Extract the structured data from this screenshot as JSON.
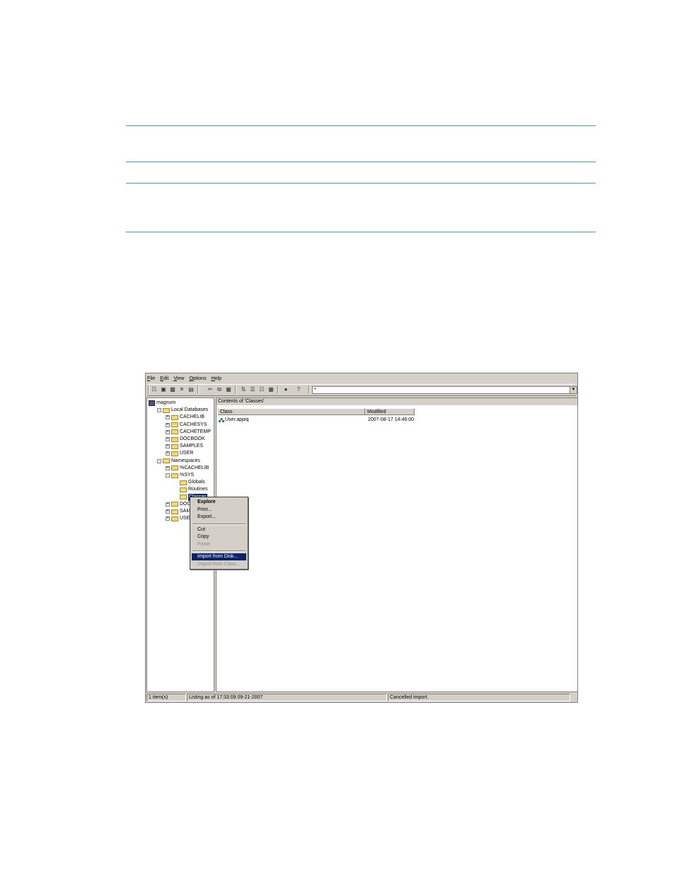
{
  "window": {
    "menu": [
      "File",
      "Edit",
      "View",
      "Options",
      "Help"
    ],
    "filter_value": "*",
    "tree": [
      {
        "label": "magnum",
        "depth": 0,
        "icon": "computer-icon",
        "expander": ""
      },
      {
        "label": "Local Databases",
        "depth": 1,
        "icon": "folder-icon",
        "expander": "-"
      },
      {
        "label": "CACHELIB",
        "depth": 2,
        "icon": "folder-icon",
        "expander": "+"
      },
      {
        "label": "CACHESYS",
        "depth": 2,
        "icon": "folder-icon",
        "expander": "+"
      },
      {
        "label": "CACHETEMP",
        "depth": 2,
        "icon": "folder-icon",
        "expander": "+"
      },
      {
        "label": "DOCBOOK",
        "depth": 2,
        "icon": "folder-icon",
        "expander": "+"
      },
      {
        "label": "SAMPLES",
        "depth": 2,
        "icon": "folder-icon",
        "expander": "+"
      },
      {
        "label": "USER",
        "depth": 2,
        "icon": "folder-icon",
        "expander": "+"
      },
      {
        "label": "Namespaces",
        "depth": 1,
        "icon": "folder-icon",
        "expander": "-"
      },
      {
        "label": "%CACHELIB",
        "depth": 2,
        "icon": "folder-icon",
        "expander": "+"
      },
      {
        "label": "%SYS",
        "depth": 2,
        "icon": "folder-icon",
        "expander": "-"
      },
      {
        "label": "Globals",
        "depth": 3,
        "icon": "folder-icon",
        "expander": ""
      },
      {
        "label": "Routines",
        "depth": 3,
        "icon": "folder-icon",
        "expander": ""
      },
      {
        "label": "Classes",
        "depth": 3,
        "icon": "folder-icon",
        "expander": "",
        "selected": true
      },
      {
        "label": "DOCBOO",
        "depth": 2,
        "icon": "folder-icon",
        "expander": "+"
      },
      {
        "label": "SAMPLE",
        "depth": 2,
        "icon": "folder-icon",
        "expander": "+"
      },
      {
        "label": "USER",
        "depth": 2,
        "icon": "folder-icon",
        "expander": "+"
      }
    ],
    "contents_caption": "Contents of 'Classes'",
    "columns": [
      "Class",
      "Modified"
    ],
    "rows": [
      {
        "class": "User.appiq",
        "modified": "2007-08-17 14:46:00"
      }
    ],
    "context_menu": [
      {
        "label": "Explore",
        "style": "bold"
      },
      {
        "label": "Print...",
        "style": "normal"
      },
      {
        "label": "Export...",
        "style": "normal"
      },
      {
        "separator": true
      },
      {
        "label": "Cut",
        "style": "normal"
      },
      {
        "label": "Copy",
        "style": "normal"
      },
      {
        "label": "Paste",
        "style": "disabled"
      },
      {
        "separator": true
      },
      {
        "label": "Import from Disk...",
        "style": "highlighted"
      },
      {
        "label": "Import from Class...",
        "style": "disabled"
      }
    ],
    "status": {
      "items": "1 item(s)",
      "listing": "Listing as of 17:33:09 09-21-2007",
      "message": "Cancelled import."
    }
  }
}
